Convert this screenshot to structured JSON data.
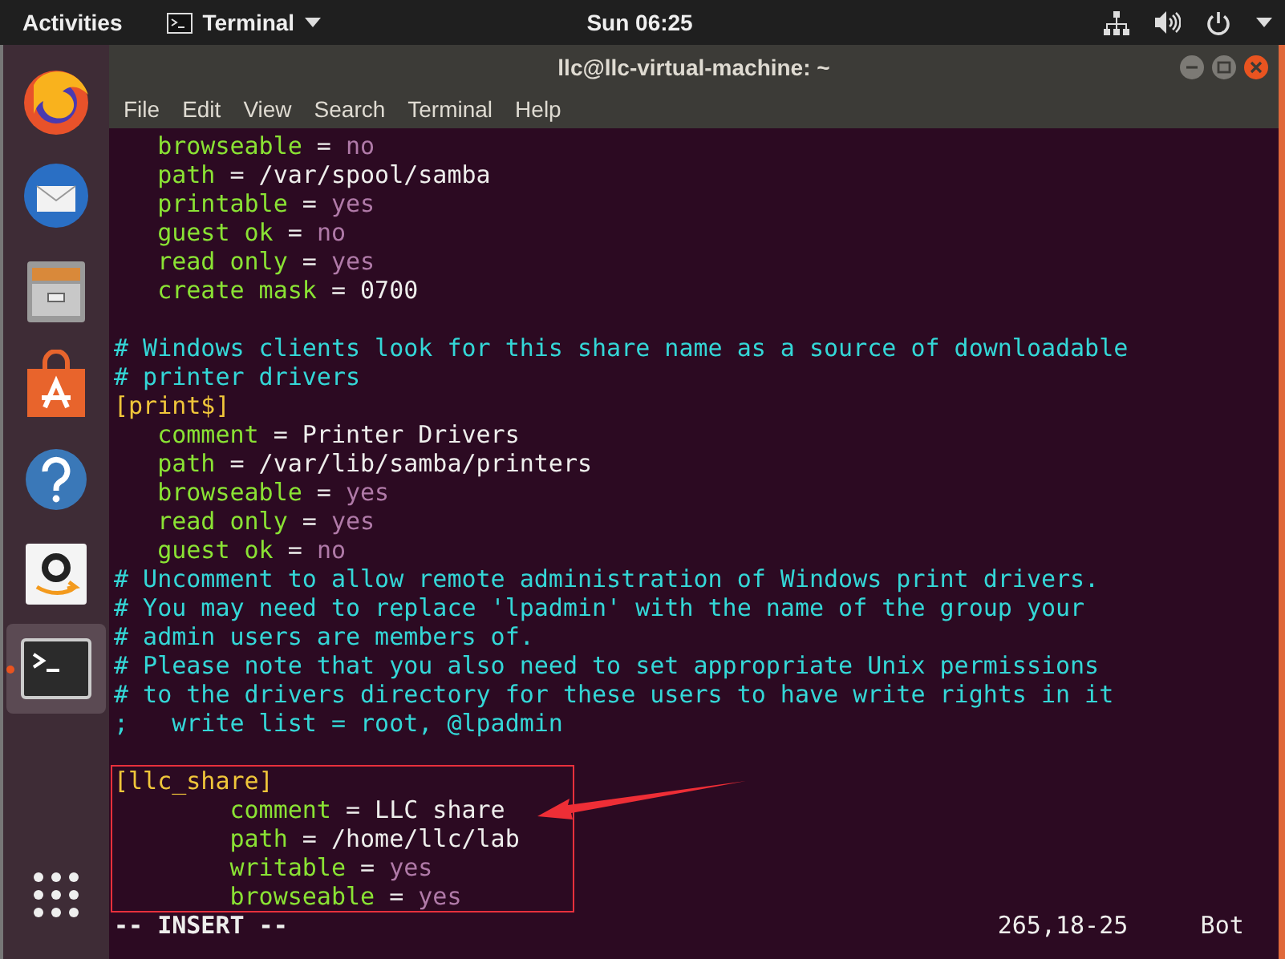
{
  "top_bar": {
    "activities": "Activities",
    "app_menu": "Terminal",
    "clock": "Sun 06:25"
  },
  "dock": [
    {
      "kind": "browser",
      "active": false
    },
    {
      "kind": "mail",
      "active": false
    },
    {
      "kind": "files",
      "active": false
    },
    {
      "kind": "store",
      "active": false
    },
    {
      "kind": "help",
      "active": false
    },
    {
      "kind": "shop",
      "active": false
    },
    {
      "kind": "terminal",
      "active": true
    },
    {
      "kind": "apps",
      "active": false
    }
  ],
  "window": {
    "title": "llc@llc-virtual-machine: ~",
    "menu": [
      "File",
      "Edit",
      "View",
      "Search",
      "Terminal",
      "Help"
    ]
  },
  "lines": [
    {
      "kind": "code",
      "highlighted": false,
      "segments": [
        {
          "kind": "key",
          "text": "   browseable"
        },
        {
          "kind": "plain",
          "text": " = "
        },
        {
          "kind": "bool",
          "text": "no"
        }
      ]
    },
    {
      "kind": "code",
      "highlighted": false,
      "segments": [
        {
          "kind": "key",
          "text": "   path"
        },
        {
          "kind": "plain",
          "text": " = /var/spool/samba"
        }
      ]
    },
    {
      "kind": "code",
      "highlighted": false,
      "segments": [
        {
          "kind": "key",
          "text": "   printable"
        },
        {
          "kind": "plain",
          "text": " = "
        },
        {
          "kind": "bool",
          "text": "yes"
        }
      ]
    },
    {
      "kind": "code",
      "highlighted": false,
      "segments": [
        {
          "kind": "key",
          "text": "   guest ok"
        },
        {
          "kind": "plain",
          "text": " = "
        },
        {
          "kind": "bool",
          "text": "no"
        }
      ]
    },
    {
      "kind": "code",
      "highlighted": false,
      "segments": [
        {
          "kind": "key",
          "text": "   read only"
        },
        {
          "kind": "plain",
          "text": " = "
        },
        {
          "kind": "bool",
          "text": "yes"
        }
      ]
    },
    {
      "kind": "code",
      "highlighted": false,
      "segments": [
        {
          "kind": "key",
          "text": "   create mask"
        },
        {
          "kind": "plain",
          "text": " = 0700"
        }
      ]
    },
    {
      "kind": "blank",
      "highlighted": false
    },
    {
      "kind": "code",
      "highlighted": false,
      "segments": [
        {
          "kind": "comment",
          "text": "# Windows clients look for this share name as a source of downloadable"
        }
      ]
    },
    {
      "kind": "code",
      "highlighted": false,
      "segments": [
        {
          "kind": "comment",
          "text": "# printer drivers"
        }
      ]
    },
    {
      "kind": "code",
      "highlighted": false,
      "segments": [
        {
          "kind": "section",
          "text": "[print$]"
        }
      ]
    },
    {
      "kind": "code",
      "highlighted": false,
      "segments": [
        {
          "kind": "key",
          "text": "   comment"
        },
        {
          "kind": "plain",
          "text": " = Printer Drivers"
        }
      ]
    },
    {
      "kind": "code",
      "highlighted": false,
      "segments": [
        {
          "kind": "key",
          "text": "   path"
        },
        {
          "kind": "plain",
          "text": " = /var/lib/samba/printers"
        }
      ]
    },
    {
      "kind": "code",
      "highlighted": false,
      "segments": [
        {
          "kind": "key",
          "text": "   browseable"
        },
        {
          "kind": "plain",
          "text": " = "
        },
        {
          "kind": "bool",
          "text": "yes"
        }
      ]
    },
    {
      "kind": "code",
      "highlighted": false,
      "segments": [
        {
          "kind": "key",
          "text": "   read only"
        },
        {
          "kind": "plain",
          "text": " = "
        },
        {
          "kind": "bool",
          "text": "yes"
        }
      ]
    },
    {
      "kind": "code",
      "highlighted": false,
      "segments": [
        {
          "kind": "key",
          "text": "   guest ok"
        },
        {
          "kind": "plain",
          "text": " = "
        },
        {
          "kind": "bool",
          "text": "no"
        }
      ]
    },
    {
      "kind": "code",
      "highlighted": false,
      "segments": [
        {
          "kind": "comment",
          "text": "# Uncomment to allow remote administration of Windows print drivers."
        }
      ]
    },
    {
      "kind": "code",
      "highlighted": false,
      "segments": [
        {
          "kind": "comment",
          "text": "# You may need to replace 'lpadmin' with the name of the group your"
        }
      ]
    },
    {
      "kind": "code",
      "highlighted": false,
      "segments": [
        {
          "kind": "comment",
          "text": "# admin users are members of."
        }
      ]
    },
    {
      "kind": "code",
      "highlighted": false,
      "segments": [
        {
          "kind": "comment",
          "text": "# Please note that you also need to set appropriate Unix permissions"
        }
      ]
    },
    {
      "kind": "code",
      "highlighted": false,
      "segments": [
        {
          "kind": "comment",
          "text": "# to the drivers directory for these users to have write rights in it"
        }
      ]
    },
    {
      "kind": "code",
      "highlighted": false,
      "segments": [
        {
          "kind": "comment",
          "text": ";   write list = root, @lpadmin"
        }
      ]
    },
    {
      "kind": "blank",
      "highlighted": false
    },
    {
      "kind": "code",
      "highlighted": true,
      "segments": [
        {
          "kind": "section",
          "text": "[llc_share]"
        }
      ]
    },
    {
      "kind": "code",
      "highlighted": true,
      "segments": [
        {
          "kind": "key",
          "text": "        comment"
        },
        {
          "kind": "plain",
          "text": " = LLC share"
        }
      ]
    },
    {
      "kind": "code",
      "highlighted": true,
      "segments": [
        {
          "kind": "key",
          "text": "        path"
        },
        {
          "kind": "plain",
          "text": " = /home/llc/lab"
        }
      ]
    },
    {
      "kind": "code",
      "highlighted": true,
      "segments": [
        {
          "kind": "key",
          "text": "        writable"
        },
        {
          "kind": "plain",
          "text": " = "
        },
        {
          "kind": "bool",
          "text": "yes"
        }
      ]
    },
    {
      "kind": "code",
      "highlighted": true,
      "segments": [
        {
          "kind": "key",
          "text": "        browseable"
        },
        {
          "kind": "plain",
          "text": " = "
        },
        {
          "kind": "bool",
          "text": "yes"
        }
      ]
    }
  ],
  "status_line": {
    "mode": "-- INSERT --",
    "position": "265,18-25",
    "scroll": "Bot"
  }
}
